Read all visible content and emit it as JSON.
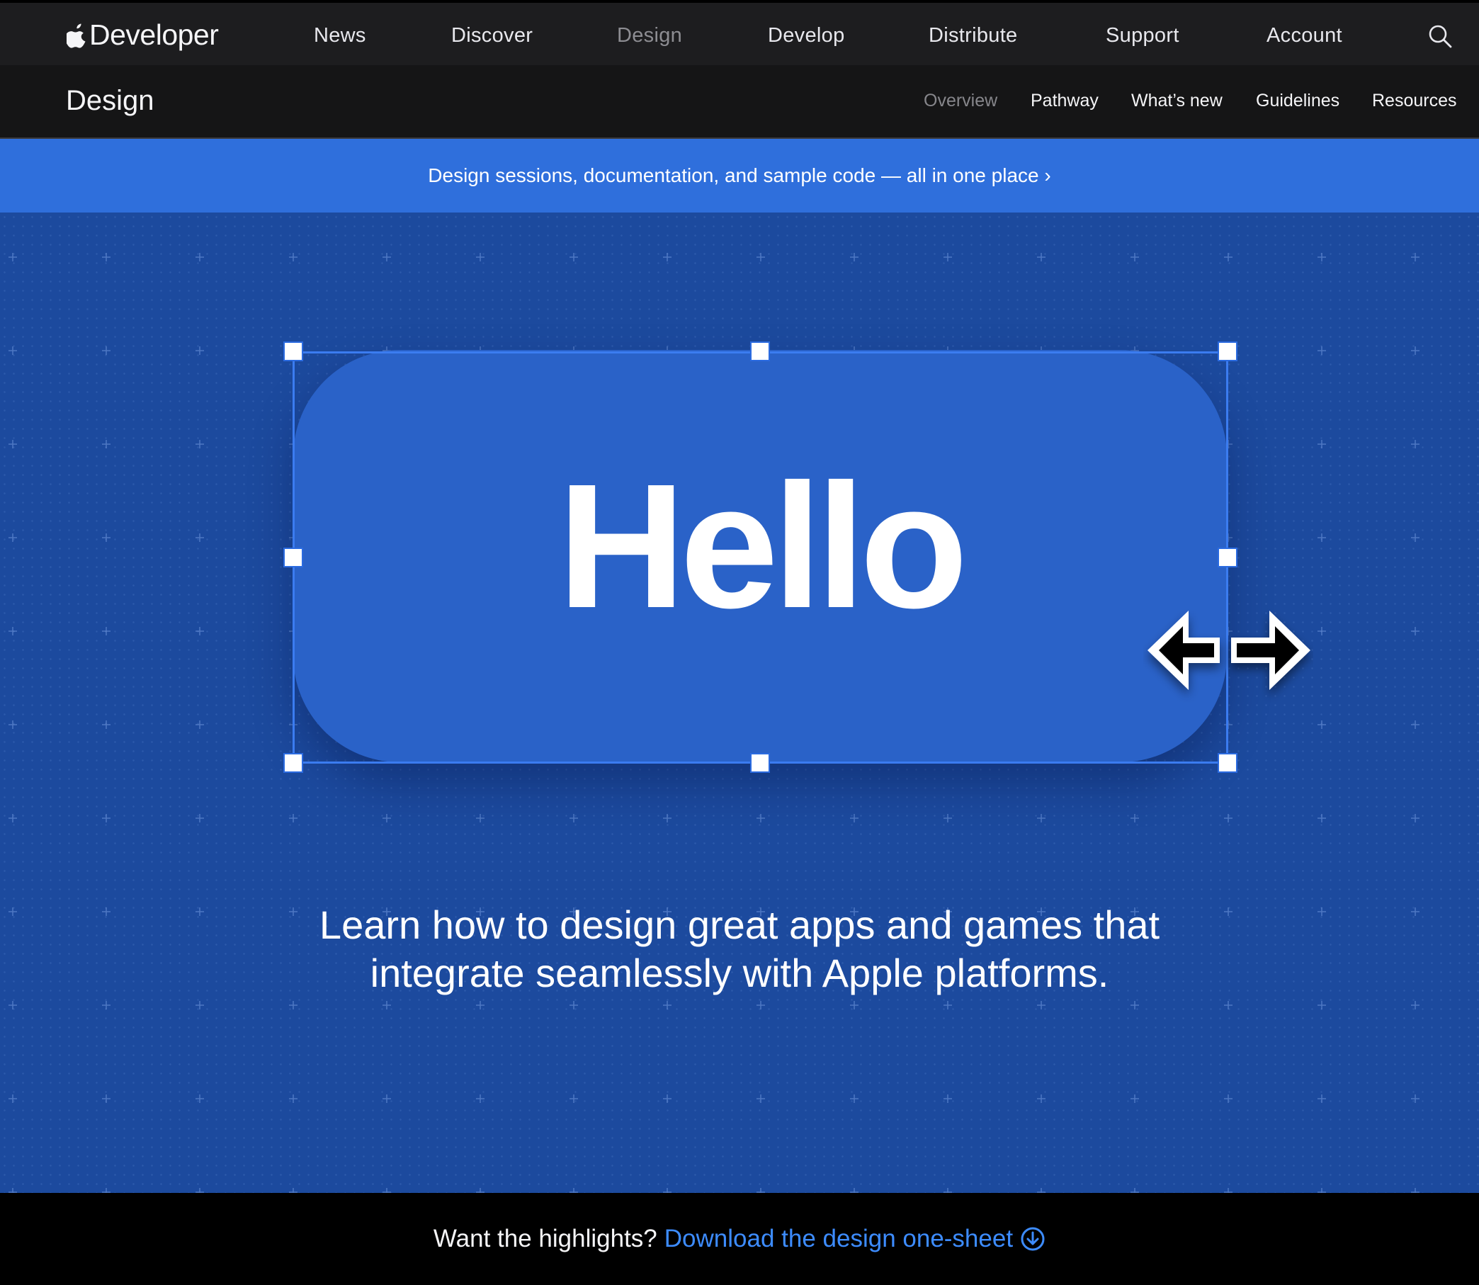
{
  "global_nav": {
    "brand": "Developer",
    "items": [
      {
        "label": "News",
        "active": false
      },
      {
        "label": "Discover",
        "active": false
      },
      {
        "label": "Design",
        "active": true
      },
      {
        "label": "Develop",
        "active": false
      },
      {
        "label": "Distribute",
        "active": false
      },
      {
        "label": "Support",
        "active": false
      },
      {
        "label": "Account",
        "active": false
      }
    ],
    "search_icon": "search-icon"
  },
  "local_nav": {
    "title": "Design",
    "items": [
      {
        "label": "Overview",
        "active": true
      },
      {
        "label": "Pathway",
        "active": false
      },
      {
        "label": "What’s new",
        "active": false
      },
      {
        "label": "Guidelines",
        "active": false
      },
      {
        "label": "Resources",
        "active": false
      }
    ]
  },
  "banner": {
    "text": "Design sessions, documentation, and sample code — all in one place ›"
  },
  "hero": {
    "button_text": "Hello",
    "copy_line1": "Learn how to design great apps and games that",
    "copy_line2": "integrate seamlessly with Apple platforms."
  },
  "bottom_bar": {
    "lead": "Want the highlights?",
    "link": "Download the design one-sheet",
    "link_icon": "download-circle-icon"
  },
  "colors": {
    "nav_bg": "#1d1d1f",
    "local_nav_bg": "#151516",
    "banner_bg": "#2f6fdc",
    "hero_bg": "#1c4a9e",
    "button_bg": "#2a62c8",
    "link": "#3d8cff"
  }
}
